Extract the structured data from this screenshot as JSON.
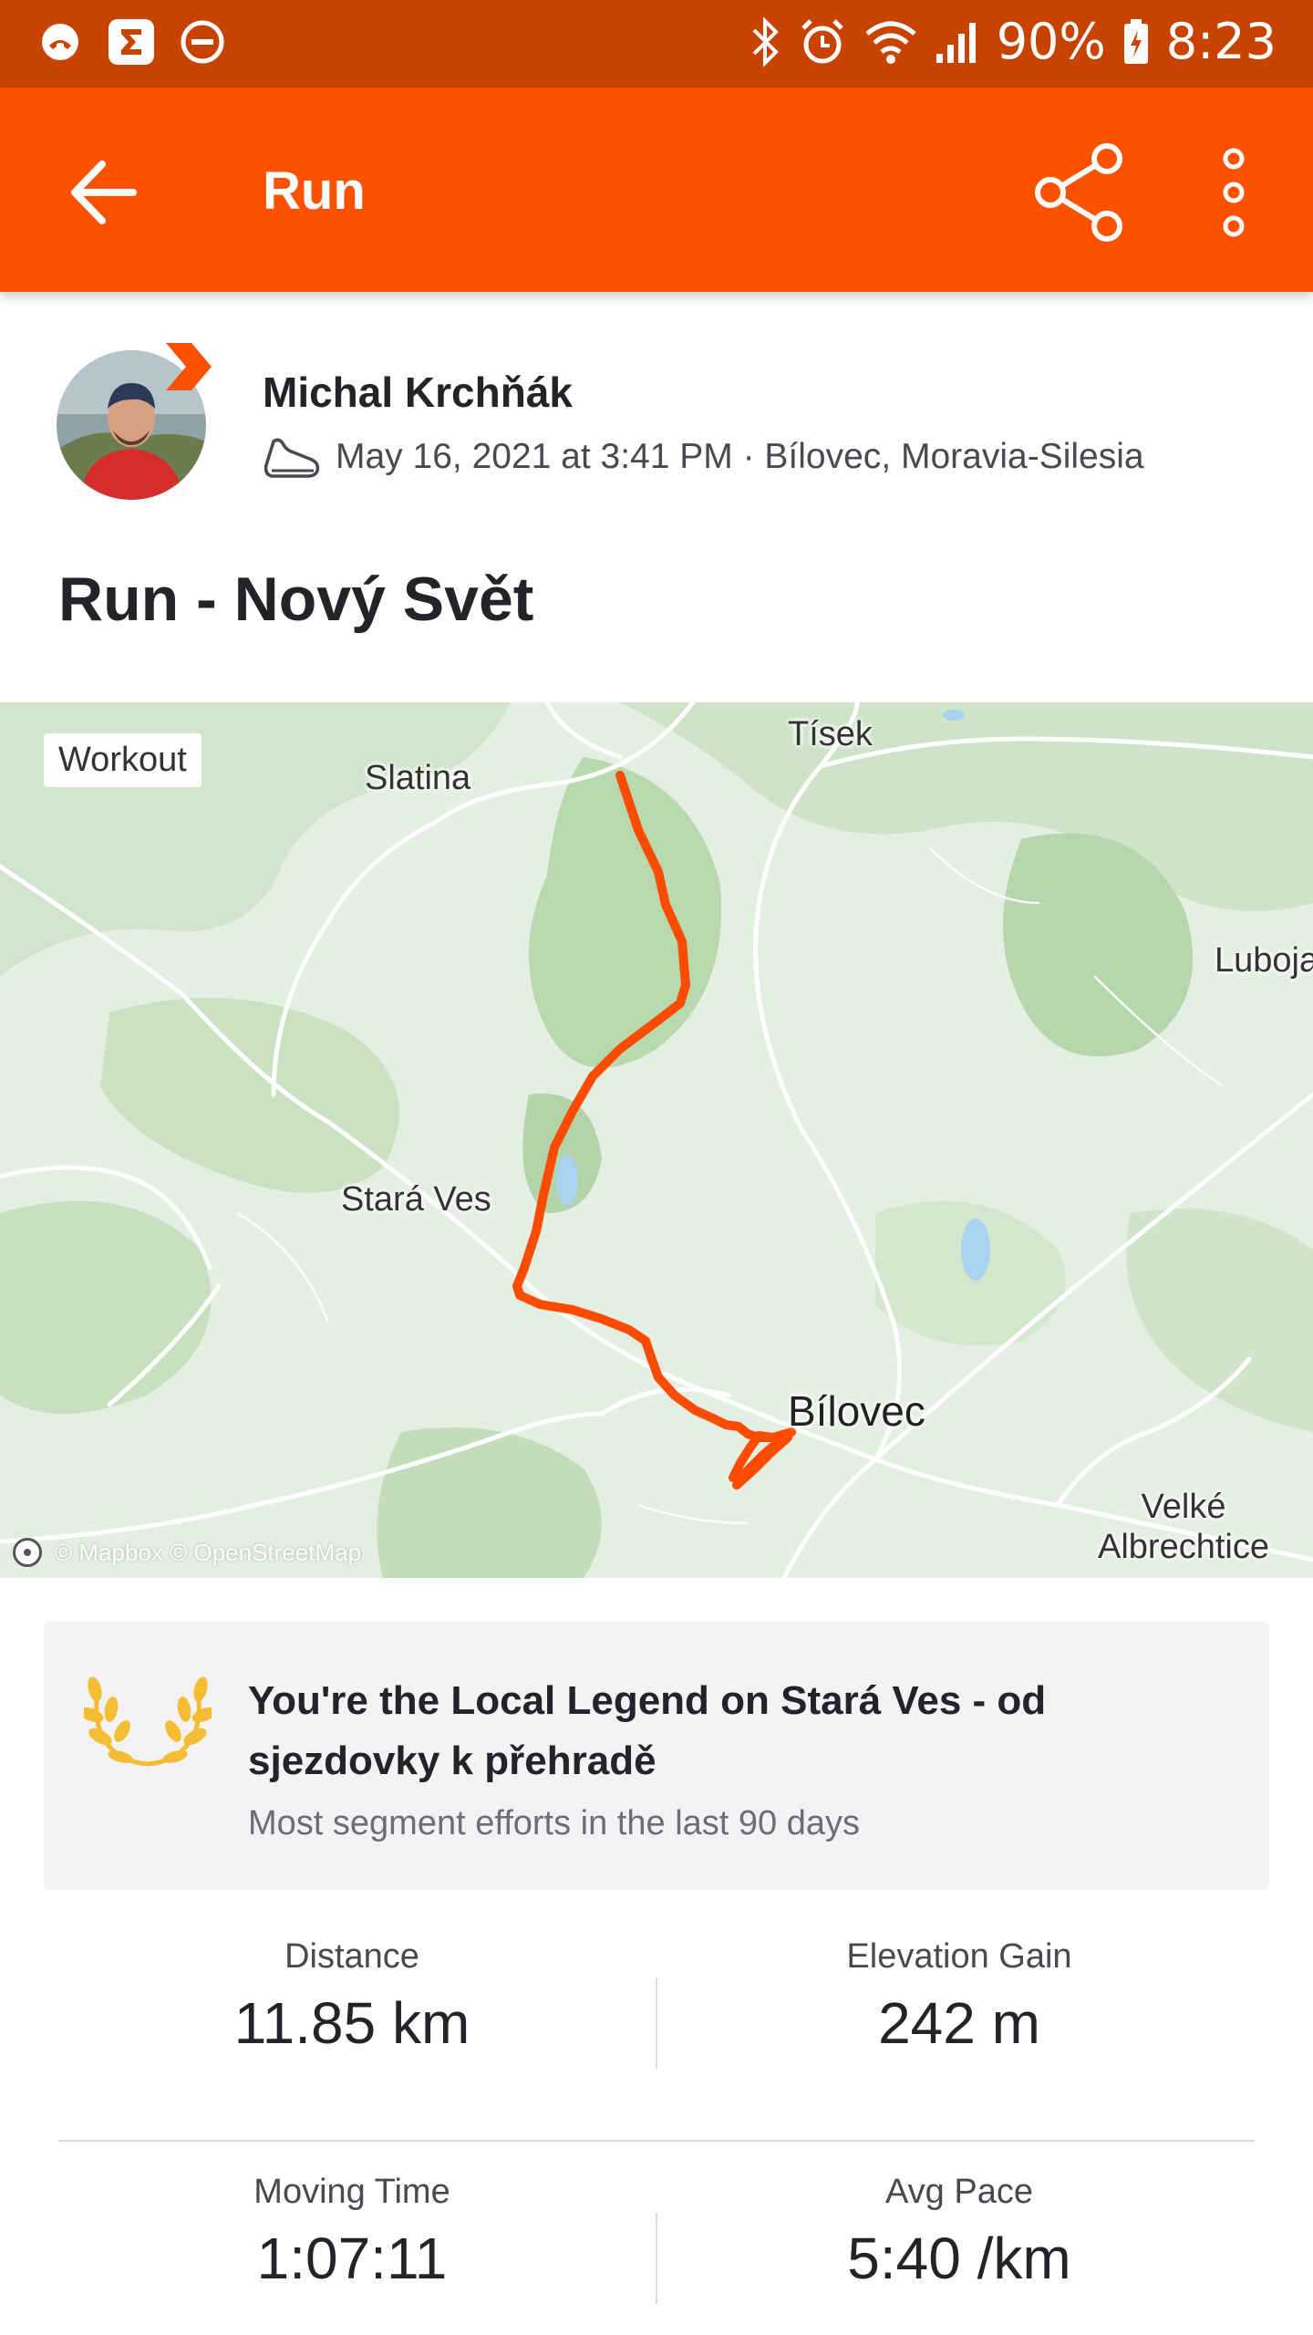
{
  "status_bar": {
    "battery": "90%",
    "time": "8:23"
  },
  "app_bar": {
    "title": "Run"
  },
  "athlete": {
    "name": "Michal Krchňák",
    "meta": "May 16, 2021 at 3:41 PM · Bílovec, Moravia-Silesia"
  },
  "activity": {
    "title": "Run - Nový Svět"
  },
  "map": {
    "chip": "Workout",
    "labels": {
      "tisek": "Tísek",
      "slatina": "Slatina",
      "luboja": "Luboja",
      "stara_ves": "Stará Ves",
      "bilovec": "Bílovec",
      "velke_albrechtice": "Velké\nAlbrechtice"
    },
    "attribution": "© Mapbox © OpenStreetMap",
    "route_color": "#fc4c02"
  },
  "local_legend": {
    "title": "You're the Local Legend on Stará Ves - od sjezdovky k přehradě",
    "subtitle": "Most segment efforts in the last 90 days"
  },
  "stats": {
    "distance": {
      "label": "Distance",
      "value": "11.85 km"
    },
    "elevation": {
      "label": "Elevation Gain",
      "value": "242 m"
    },
    "moving_time": {
      "label": "Moving Time",
      "value": "1:07:11"
    },
    "avg_pace": {
      "label": "Avg Pace",
      "value": "5:40 /km"
    }
  },
  "colors": {
    "brand": "#fc5200",
    "status_bar": "#c84200",
    "laurel": "#f4bd33"
  }
}
